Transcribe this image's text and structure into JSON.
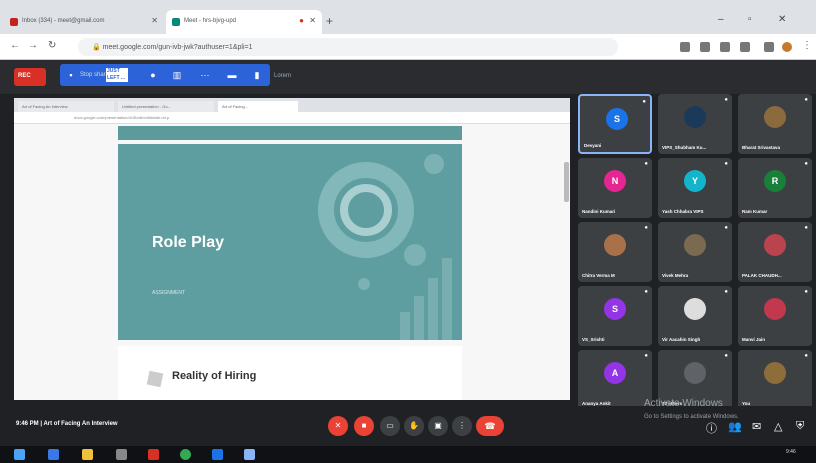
{
  "browser": {
    "tabs": [
      {
        "label": "Inbox (334) - meet@gmail.com",
        "active": false
      },
      {
        "label": "Meet - hrs-bjvg-upd",
        "active": true
      }
    ],
    "url": "meet.google.com/gun-ivb-jwk?authuser=1&pli=1"
  },
  "meet_top": {
    "record_label": "REC",
    "presenting_label": "JUST LEFT ...",
    "presenting_text": "Stop sharing",
    "tail": "Lorem"
  },
  "presented": {
    "inner_tabs": [
      "Art of Facing An Interview",
      "Untitled presentation - Go...",
      "Art of Facing..."
    ],
    "inner_url": "docs.google.com/presentation/d/1Bxr8/edit#slide=id.p",
    "slide_title": "Role Play",
    "slide_sub": "ASSIGNMENT",
    "slide2_title": "Reality of Hiring"
  },
  "participants": [
    {
      "name": "Devyani",
      "initial": "S",
      "color": "#1a73e8",
      "photo": false
    },
    {
      "name": "VIPS_Shubham Ku...",
      "initial": "",
      "color": "#1b3a5a",
      "photo": true
    },
    {
      "name": "Bharat Srivastava",
      "initial": "",
      "color": "#8b6b3d",
      "photo": true
    },
    {
      "name": "Nandini Kumari",
      "initial": "N",
      "color": "#e52592",
      "photo": false
    },
    {
      "name": "Yash Chhabra VIPS",
      "initial": "Y",
      "color": "#12b5cb",
      "photo": false
    },
    {
      "name": "Ram Kumar",
      "initial": "R",
      "color": "#188038",
      "photo": false
    },
    {
      "name": "Chitra Verma M",
      "initial": "",
      "color": "#a8714a",
      "photo": true
    },
    {
      "name": "Vivek Mehra",
      "initial": "",
      "color": "#7a6a50",
      "photo": true
    },
    {
      "name": "PALAK CHAUDH...",
      "initial": "",
      "color": "#b9444e",
      "photo": true
    },
    {
      "name": "VS_Srishti",
      "initial": "S",
      "color": "#9334e6",
      "photo": false
    },
    {
      "name": "Vir Aacahin Singh",
      "initial": "",
      "color": "#ddd",
      "photo": true
    },
    {
      "name": "Manvi Jain",
      "initial": "",
      "color": "#c2384c",
      "photo": true
    },
    {
      "name": "Ananya Ankit",
      "initial": "A",
      "color": "#9334e6",
      "photo": false
    },
    {
      "name": "37 others",
      "initial": "",
      "color": "#5f6368",
      "photo": false
    },
    {
      "name": "You",
      "initial": "",
      "color": "#8d6e3a",
      "photo": true
    }
  ],
  "bottom": {
    "meeting_info": "9:46 PM | Art of Facing An Interview",
    "end_icon": "phone-hangup-icon"
  },
  "watermark": {
    "line1": "Activate Windows",
    "line2": "Go to Settings to activate Windows."
  },
  "taskbar": {
    "time": "9:46"
  }
}
